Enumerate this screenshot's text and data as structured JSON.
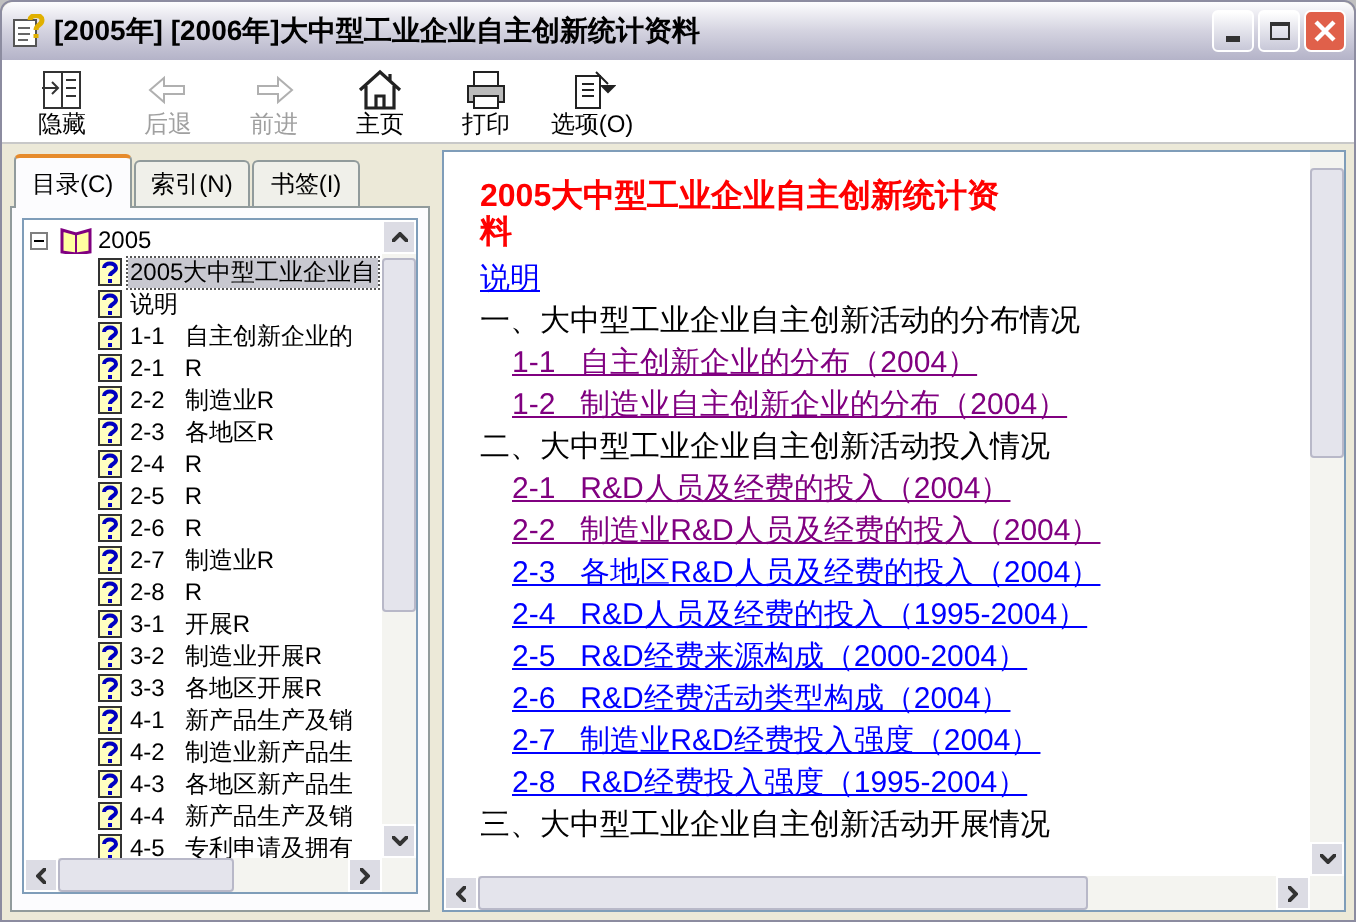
{
  "window": {
    "title": "[2005年] [2006年]大中型工业企业自主创新统计资料"
  },
  "toolbar": [
    {
      "kind": "hide",
      "label": "隐藏",
      "disabled": false
    },
    {
      "kind": "back",
      "label": "后退",
      "disabled": true
    },
    {
      "kind": "forward",
      "label": "前进",
      "disabled": true
    },
    {
      "kind": "home",
      "label": "主页",
      "disabled": false
    },
    {
      "kind": "print",
      "label": "打印",
      "disabled": false
    },
    {
      "kind": "options",
      "label": "选项(O)",
      "disabled": false
    }
  ],
  "tabs": [
    {
      "label": "目录(C)",
      "selected": true
    },
    {
      "label": "索引(N)",
      "selected": false
    },
    {
      "label": "书签(I)",
      "selected": false
    }
  ],
  "tree": {
    "label": "2005",
    "expanded": true,
    "children": [
      {
        "label": "2005大中型工业企业自",
        "selected": true
      },
      {
        "label": "说明",
        "selected": false
      },
      {
        "label": "1-1   自主创新企业的",
        "selected": false
      },
      {
        "label": "2-1   R",
        "selected": false
      },
      {
        "label": "2-2   制造业R",
        "selected": false
      },
      {
        "label": "2-3   各地区R",
        "selected": false
      },
      {
        "label": "2-4   R",
        "selected": false
      },
      {
        "label": "2-5   R",
        "selected": false
      },
      {
        "label": "2-6   R",
        "selected": false
      },
      {
        "label": "2-7   制造业R",
        "selected": false
      },
      {
        "label": "2-8   R",
        "selected": false
      },
      {
        "label": "3-1   开展R",
        "selected": false
      },
      {
        "label": "3-2   制造业开展R",
        "selected": false
      },
      {
        "label": "3-3   各地区开展R",
        "selected": false
      },
      {
        "label": "4-1   新产品生产及销",
        "selected": false
      },
      {
        "label": "4-2   制造业新产品生",
        "selected": false
      },
      {
        "label": "4-3   各地区新产品生",
        "selected": false
      },
      {
        "label": "4-4   新产品生产及销",
        "selected": false
      },
      {
        "label": "4-5   专利申请及拥有",
        "selected": false
      }
    ]
  },
  "content": {
    "title": "2005大中型工业企业自主创新统计资料",
    "entries": [
      {
        "kind": "link",
        "text": "说明",
        "visited": false
      },
      {
        "kind": "heading",
        "text": "一、大中型工业企业自主创新活动的分布情况"
      },
      {
        "kind": "sublink",
        "text": "1-1   自主创新企业的分布（2004）",
        "visited": true
      },
      {
        "kind": "sublink",
        "text": "1-2   制造业自主创新企业的分布（2004）",
        "visited": true
      },
      {
        "kind": "heading",
        "text": "二、大中型工业企业自主创新活动投入情况"
      },
      {
        "kind": "sublink",
        "text": "2-1   R&D人员及经费的投入（2004）",
        "visited": true
      },
      {
        "kind": "sublink",
        "text": "2-2   制造业R&D人员及经费的投入（2004）",
        "visited": true
      },
      {
        "kind": "sublink",
        "text": "2-3   各地区R&D人员及经费的投入（2004）",
        "visited": false
      },
      {
        "kind": "sublink",
        "text": "2-4   R&D人员及经费的投入（1995-2004）",
        "visited": false
      },
      {
        "kind": "sublink",
        "text": "2-5   R&D经费来源构成（2000-2004）",
        "visited": false
      },
      {
        "kind": "sublink",
        "text": "2-6   R&D经费活动类型构成（2004）",
        "visited": false
      },
      {
        "kind": "sublink",
        "text": "2-7   制造业R&D经费投入强度（2004）",
        "visited": false
      },
      {
        "kind": "sublink",
        "text": "2-8   R&D经费投入强度（1995-2004）",
        "visited": false
      },
      {
        "kind": "heading",
        "text": "三、大中型工业企业自主创新活动开展情况"
      }
    ]
  }
}
